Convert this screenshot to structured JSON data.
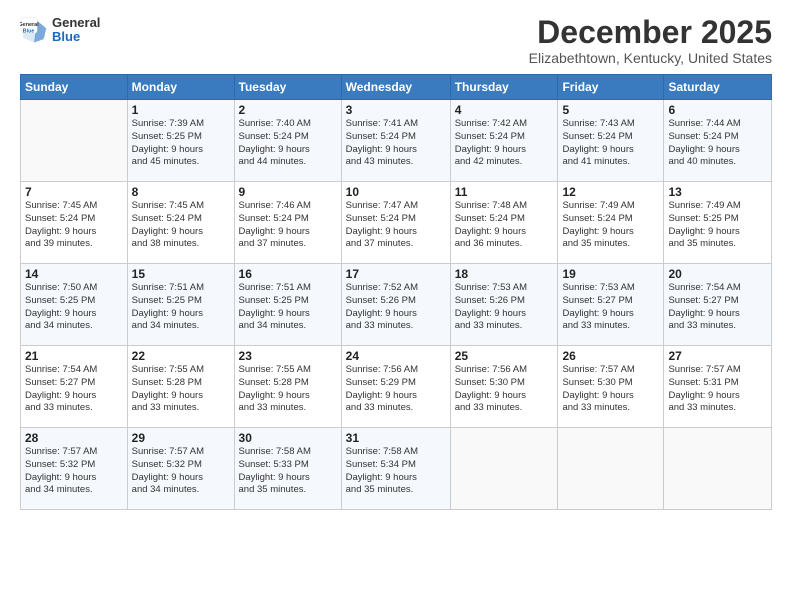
{
  "header": {
    "logo": {
      "general": "General",
      "blue": "Blue"
    },
    "title": "December 2025",
    "location": "Elizabethtown, Kentucky, United States"
  },
  "days_of_week": [
    "Sunday",
    "Monday",
    "Tuesday",
    "Wednesday",
    "Thursday",
    "Friday",
    "Saturday"
  ],
  "weeks": [
    [
      {
        "day": "",
        "info": ""
      },
      {
        "day": "1",
        "info": "Sunrise: 7:39 AM\nSunset: 5:25 PM\nDaylight: 9 hours\nand 45 minutes."
      },
      {
        "day": "2",
        "info": "Sunrise: 7:40 AM\nSunset: 5:24 PM\nDaylight: 9 hours\nand 44 minutes."
      },
      {
        "day": "3",
        "info": "Sunrise: 7:41 AM\nSunset: 5:24 PM\nDaylight: 9 hours\nand 43 minutes."
      },
      {
        "day": "4",
        "info": "Sunrise: 7:42 AM\nSunset: 5:24 PM\nDaylight: 9 hours\nand 42 minutes."
      },
      {
        "day": "5",
        "info": "Sunrise: 7:43 AM\nSunset: 5:24 PM\nDaylight: 9 hours\nand 41 minutes."
      },
      {
        "day": "6",
        "info": "Sunrise: 7:44 AM\nSunset: 5:24 PM\nDaylight: 9 hours\nand 40 minutes."
      }
    ],
    [
      {
        "day": "7",
        "info": "Sunrise: 7:45 AM\nSunset: 5:24 PM\nDaylight: 9 hours\nand 39 minutes."
      },
      {
        "day": "8",
        "info": "Sunrise: 7:45 AM\nSunset: 5:24 PM\nDaylight: 9 hours\nand 38 minutes."
      },
      {
        "day": "9",
        "info": "Sunrise: 7:46 AM\nSunset: 5:24 PM\nDaylight: 9 hours\nand 37 minutes."
      },
      {
        "day": "10",
        "info": "Sunrise: 7:47 AM\nSunset: 5:24 PM\nDaylight: 9 hours\nand 37 minutes."
      },
      {
        "day": "11",
        "info": "Sunrise: 7:48 AM\nSunset: 5:24 PM\nDaylight: 9 hours\nand 36 minutes."
      },
      {
        "day": "12",
        "info": "Sunrise: 7:49 AM\nSunset: 5:24 PM\nDaylight: 9 hours\nand 35 minutes."
      },
      {
        "day": "13",
        "info": "Sunrise: 7:49 AM\nSunset: 5:25 PM\nDaylight: 9 hours\nand 35 minutes."
      }
    ],
    [
      {
        "day": "14",
        "info": "Sunrise: 7:50 AM\nSunset: 5:25 PM\nDaylight: 9 hours\nand 34 minutes."
      },
      {
        "day": "15",
        "info": "Sunrise: 7:51 AM\nSunset: 5:25 PM\nDaylight: 9 hours\nand 34 minutes."
      },
      {
        "day": "16",
        "info": "Sunrise: 7:51 AM\nSunset: 5:25 PM\nDaylight: 9 hours\nand 34 minutes."
      },
      {
        "day": "17",
        "info": "Sunrise: 7:52 AM\nSunset: 5:26 PM\nDaylight: 9 hours\nand 33 minutes."
      },
      {
        "day": "18",
        "info": "Sunrise: 7:53 AM\nSunset: 5:26 PM\nDaylight: 9 hours\nand 33 minutes."
      },
      {
        "day": "19",
        "info": "Sunrise: 7:53 AM\nSunset: 5:27 PM\nDaylight: 9 hours\nand 33 minutes."
      },
      {
        "day": "20",
        "info": "Sunrise: 7:54 AM\nSunset: 5:27 PM\nDaylight: 9 hours\nand 33 minutes."
      }
    ],
    [
      {
        "day": "21",
        "info": "Sunrise: 7:54 AM\nSunset: 5:27 PM\nDaylight: 9 hours\nand 33 minutes."
      },
      {
        "day": "22",
        "info": "Sunrise: 7:55 AM\nSunset: 5:28 PM\nDaylight: 9 hours\nand 33 minutes."
      },
      {
        "day": "23",
        "info": "Sunrise: 7:55 AM\nSunset: 5:28 PM\nDaylight: 9 hours\nand 33 minutes."
      },
      {
        "day": "24",
        "info": "Sunrise: 7:56 AM\nSunset: 5:29 PM\nDaylight: 9 hours\nand 33 minutes."
      },
      {
        "day": "25",
        "info": "Sunrise: 7:56 AM\nSunset: 5:30 PM\nDaylight: 9 hours\nand 33 minutes."
      },
      {
        "day": "26",
        "info": "Sunrise: 7:57 AM\nSunset: 5:30 PM\nDaylight: 9 hours\nand 33 minutes."
      },
      {
        "day": "27",
        "info": "Sunrise: 7:57 AM\nSunset: 5:31 PM\nDaylight: 9 hours\nand 33 minutes."
      }
    ],
    [
      {
        "day": "28",
        "info": "Sunrise: 7:57 AM\nSunset: 5:32 PM\nDaylight: 9 hours\nand 34 minutes."
      },
      {
        "day": "29",
        "info": "Sunrise: 7:57 AM\nSunset: 5:32 PM\nDaylight: 9 hours\nand 34 minutes."
      },
      {
        "day": "30",
        "info": "Sunrise: 7:58 AM\nSunset: 5:33 PM\nDaylight: 9 hours\nand 35 minutes."
      },
      {
        "day": "31",
        "info": "Sunrise: 7:58 AM\nSunset: 5:34 PM\nDaylight: 9 hours\nand 35 minutes."
      },
      {
        "day": "",
        "info": ""
      },
      {
        "day": "",
        "info": ""
      },
      {
        "day": "",
        "info": ""
      }
    ]
  ]
}
